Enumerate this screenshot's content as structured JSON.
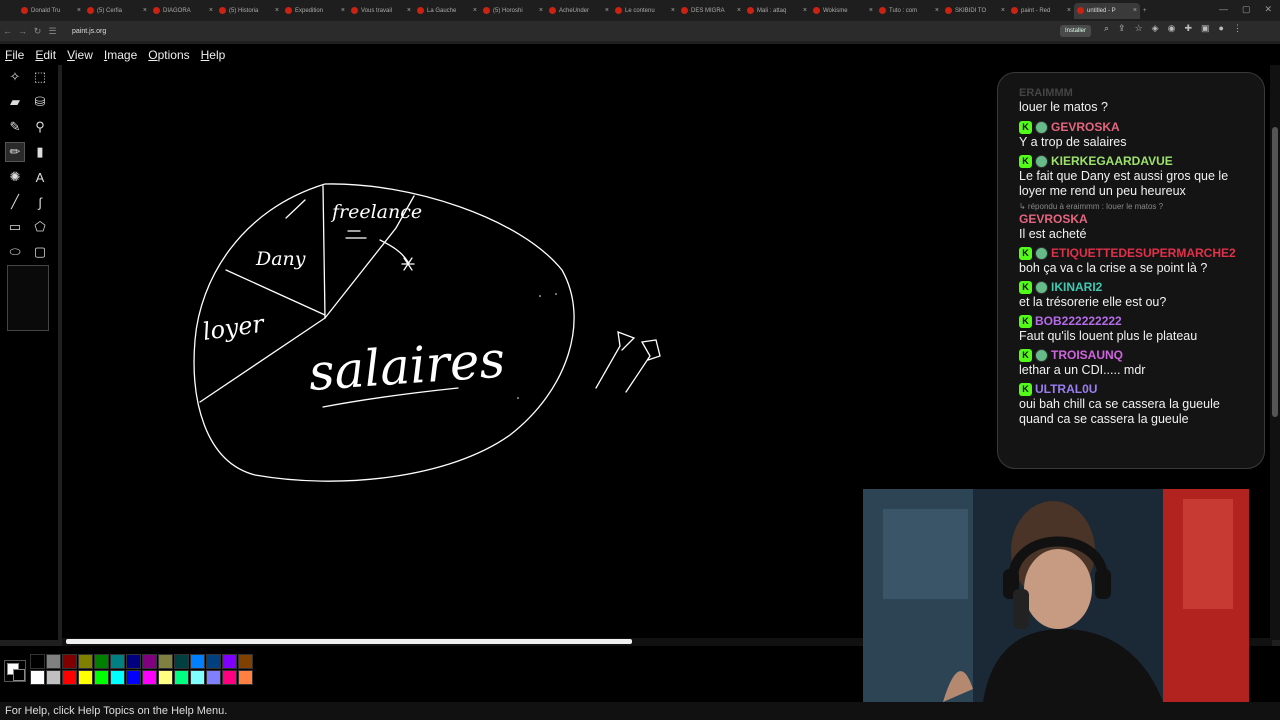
{
  "browser": {
    "tabs": [
      "Donald Tru",
      "(5) Cerfia",
      "DIAGORA",
      "(5) Historia",
      "Expedition",
      "Vous travail",
      "La Gauche",
      "(5) Horoshi",
      "AcheUnder",
      "Le contenu",
      "DES MIGRA",
      "Mali : attaq",
      "Wokisme",
      "Tuto : com",
      "SKIBIDI TO",
      "paint - Red",
      "untitled - P"
    ],
    "active_tab_index": 16,
    "url": "paint.js.org",
    "install_label": "Installer"
  },
  "menu": [
    "File",
    "Edit",
    "View",
    "Image",
    "Options",
    "Help"
  ],
  "drawing": {
    "labels": [
      "freelance",
      "Dany",
      "loyer",
      "salaires"
    ]
  },
  "palette": {
    "row1": [
      "#000000",
      "#808080",
      "#800000",
      "#808000",
      "#008000",
      "#008080",
      "#000080",
      "#800080",
      "#808040",
      "#004040",
      "#0080ff",
      "#004080",
      "#8000ff",
      "#804000"
    ],
    "row2": [
      "#ffffff",
      "#c0c0c0",
      "#ff0000",
      "#ffff00",
      "#00ff00",
      "#00ffff",
      "#0000ff",
      "#ff00ff",
      "#ffff80",
      "#00ff80",
      "#80ffff",
      "#8080ff",
      "#ff0080",
      "#ff8040"
    ]
  },
  "status": "For Help, click Help Topics on the Help Menu.",
  "chat": {
    "faded_top": "ERAIMMM",
    "first_text": "louer le matos ?",
    "messages": [
      {
        "user": "GEVROSKA",
        "color": "#e4657e",
        "text": "Y a trop de salaires",
        "badges": true
      },
      {
        "user": "KIERKEGAARDAVUE",
        "color": "#9de36b",
        "text": "Le fait que Dany est aussi gros que le loyer me rend un peu heureux",
        "badges": true
      },
      {
        "user": "GEVROSKA",
        "color": "#e4657e",
        "text": "Il est acheté",
        "badges": false,
        "reply": "↳ répondu à eraimmm : louer le matos ?"
      },
      {
        "user": "ETIQUETTEDESUPERMARCHE2",
        "color": "#e0304a",
        "text": "boh ça va c la crise a se point là ?",
        "badges": true
      },
      {
        "user": "IKINARI2",
        "color": "#3ec9b2",
        "text": "et la trésorerie elle est ou?",
        "badges": true
      },
      {
        "user": "BOB222222222",
        "color": "#b66be8",
        "text": "Faut qu'ils louent plus le plateau",
        "badges": false,
        "kbadge": true
      },
      {
        "user": "TROISAUNQ",
        "color": "#d064e0",
        "text": "lethar a un CDI..... mdr",
        "badges": true
      },
      {
        "user": "ULTRAL0U",
        "color": "#9b7ef0",
        "text": "oui bah chill ca se cassera la gueule quand ca se cassera la gueule",
        "badges": false,
        "kbadge": true
      }
    ]
  }
}
